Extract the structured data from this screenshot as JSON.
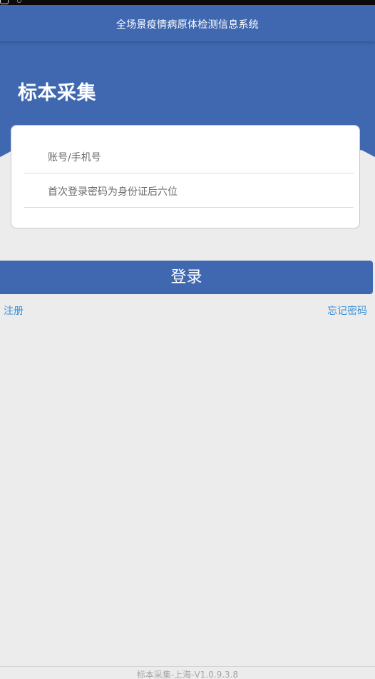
{
  "header": {
    "title": "全场景疫情病原体检测信息系统"
  },
  "banner": {
    "title": "标本采集"
  },
  "form": {
    "account_placeholder": "账号/手机号",
    "password_placeholder": "首次登录密码为身份证后六位"
  },
  "actions": {
    "login_label": "登录",
    "register_label": "注册",
    "forgot_label": "忘记密码"
  },
  "footer": {
    "version": "标本采集-上海-V1.0.9.3.8"
  },
  "colors": {
    "primary": "#4068b0",
    "link": "#3b8fd8",
    "background": "#ececec"
  }
}
